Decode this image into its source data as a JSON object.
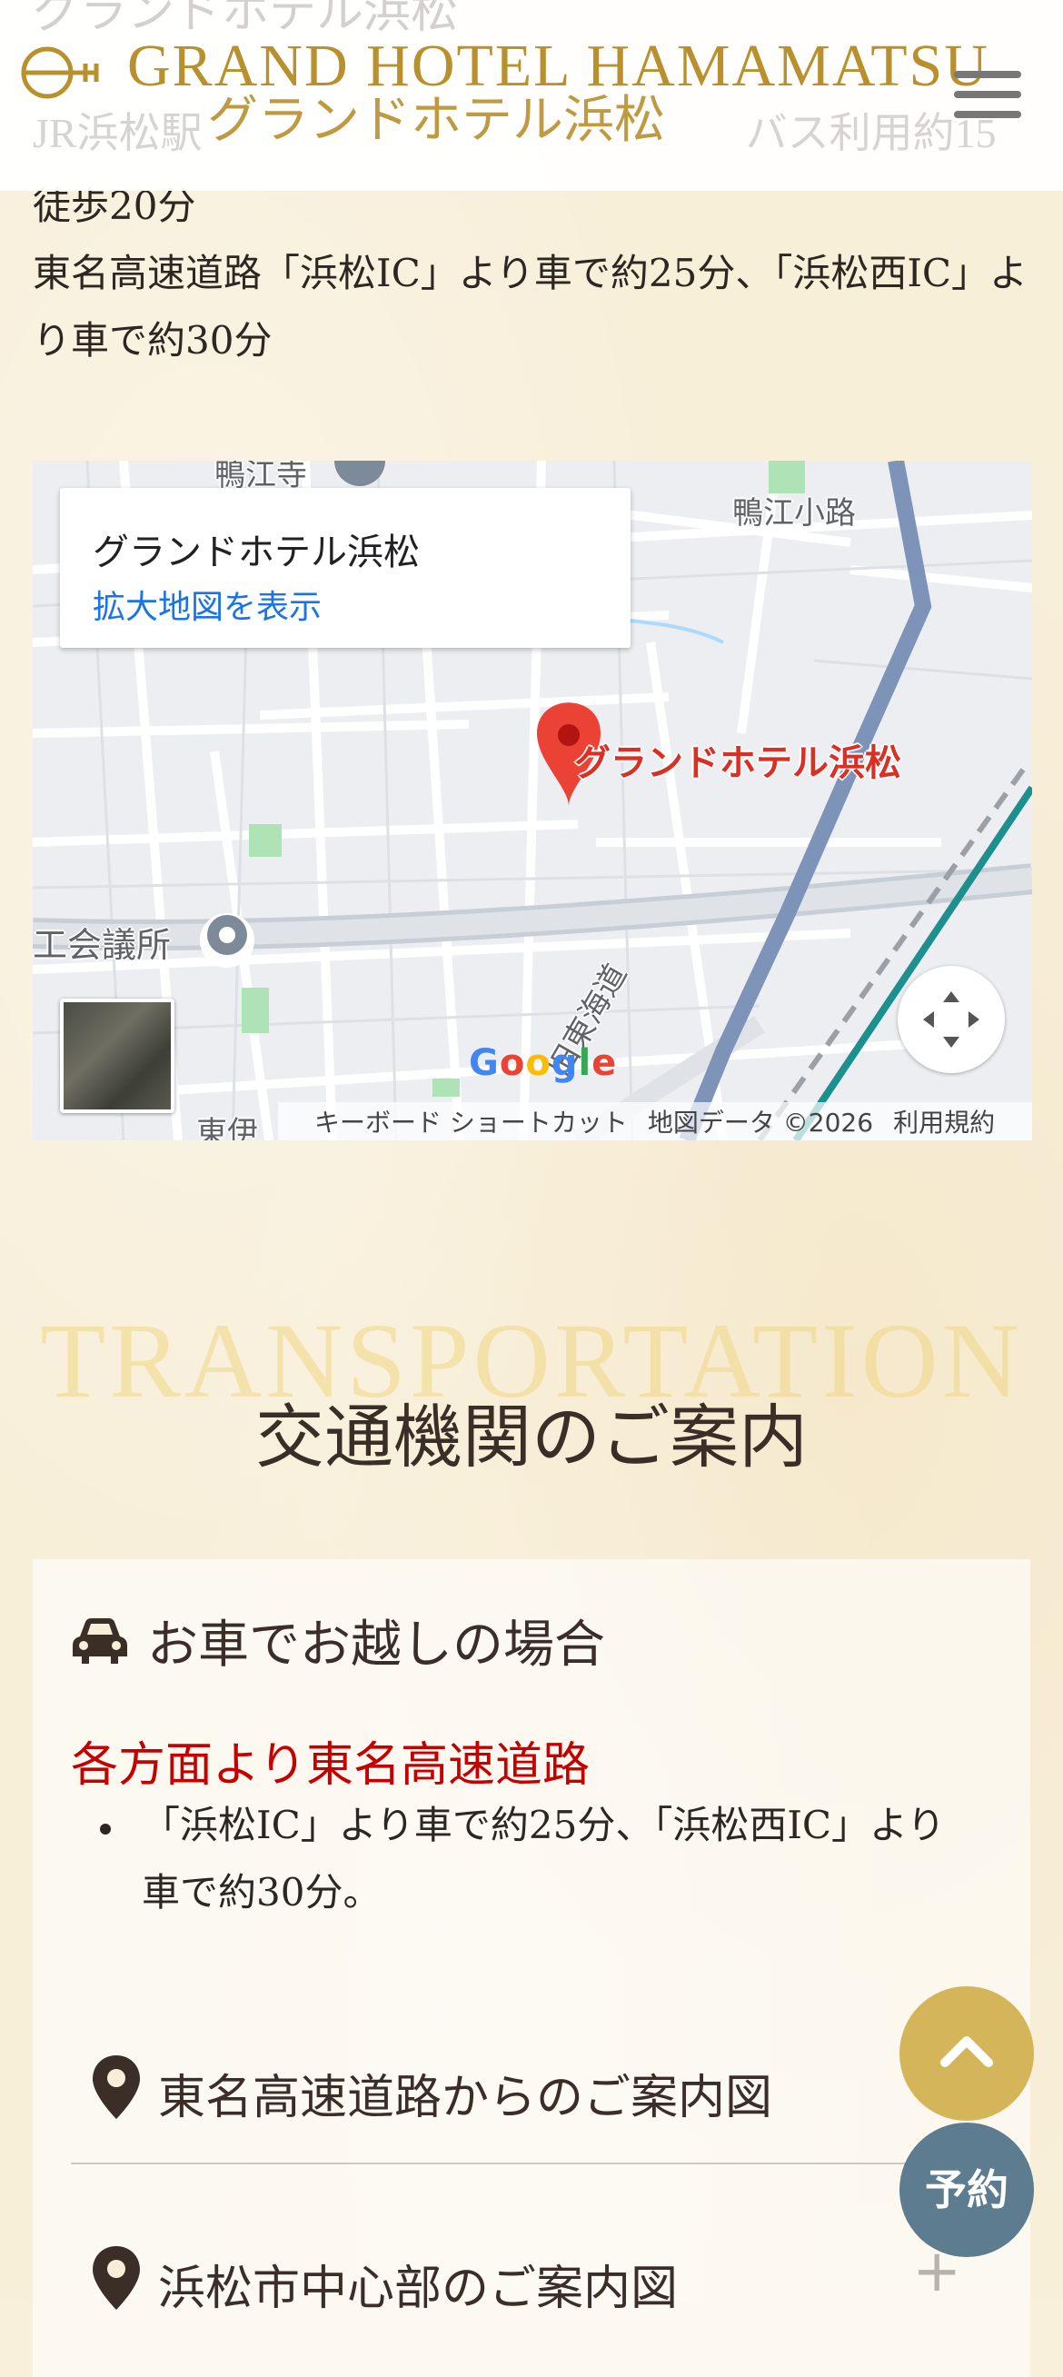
{
  "header": {
    "logo_en": "GRAND HOTEL HAMAMATSU",
    "logo_ja": "グランドホテル浜松",
    "ghost_title": "グランドホテル浜松",
    "ghost_line": "JR浜松駅　　　　　　　　　　　　　バス利用約15"
  },
  "access": {
    "partial_line": "徒歩20分",
    "highway_text": "東名高速道路「浜松IC」より車で約25分、「浜松西IC」より車で約30分"
  },
  "map": {
    "place_name": "グランドホテル浜松",
    "enlarge_link": "拡大地図を表示",
    "pin_label": "グランドホテル浜松",
    "poi_label": "工会議所",
    "road_labels": [
      "鴨江小路",
      "旧東海道",
      "鴨江寺",
      "東伊"
    ],
    "google": "Google",
    "footer": {
      "shortcuts": "キーボード ショートカット",
      "map_data": "地図データ ©2026",
      "terms": "利用規約"
    }
  },
  "section": {
    "title_en": "TRANSPORTATION",
    "title_ja": "交通機関のご案内"
  },
  "card": {
    "heading": "お車でお越しの場合",
    "subheading": "各方面より東名高速道路",
    "bullet": "「浜松IC」より車で約25分、「浜松西IC」より車で約30分。",
    "accordion": [
      {
        "label": "東名高速道路からのご案内図",
        "icon": "+"
      },
      {
        "label": "浜松市中心部のご案内図",
        "icon": "+"
      }
    ]
  },
  "floating": {
    "reserve_label": "予約"
  },
  "colors": {
    "gold": "#b8902e",
    "accent_red": "#c40000",
    "reserve_blue": "#5d7c8f",
    "top_button": "#d4b55a"
  }
}
